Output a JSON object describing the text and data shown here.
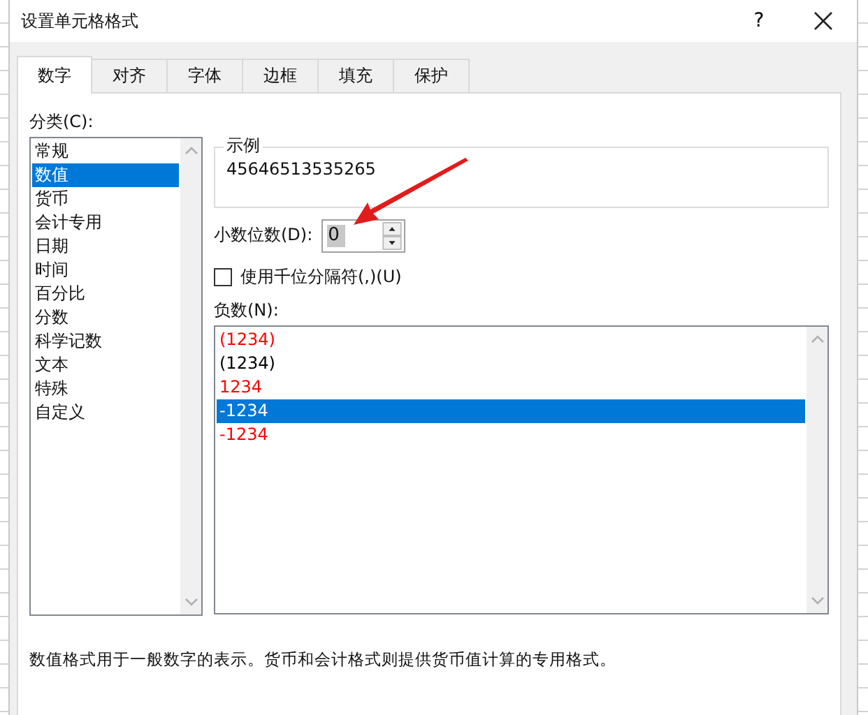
{
  "window": {
    "title": "设置单元格格式",
    "help": "?"
  },
  "tabs": [
    {
      "label": "数字",
      "selected": true
    },
    {
      "label": "对齐",
      "selected": false
    },
    {
      "label": "字体",
      "selected": false
    },
    {
      "label": "边框",
      "selected": false
    },
    {
      "label": "填充",
      "selected": false
    },
    {
      "label": "保护",
      "selected": false
    }
  ],
  "category": {
    "label": "分类(C):",
    "items": [
      {
        "label": "常规",
        "selected": false
      },
      {
        "label": "数值",
        "selected": true
      },
      {
        "label": "货币",
        "selected": false
      },
      {
        "label": "会计专用",
        "selected": false
      },
      {
        "label": "日期",
        "selected": false
      },
      {
        "label": "时间",
        "selected": false
      },
      {
        "label": "百分比",
        "selected": false
      },
      {
        "label": "分数",
        "selected": false
      },
      {
        "label": "科学记数",
        "selected": false
      },
      {
        "label": "文本",
        "selected": false
      },
      {
        "label": "特殊",
        "selected": false
      },
      {
        "label": "自定义",
        "selected": false
      }
    ]
  },
  "sample": {
    "label": "示例",
    "value": "45646513535265"
  },
  "decimal_places": {
    "label": "小数位数(D):",
    "value": "0"
  },
  "thousands_separator": {
    "label": "使用千位分隔符(,)(U)",
    "checked": false
  },
  "negative_numbers": {
    "label": "负数(N):",
    "items": [
      {
        "label": "(1234)",
        "color": "#ff0000",
        "selected": false
      },
      {
        "label": "(1234)",
        "color": "#000000",
        "selected": false
      },
      {
        "label": "1234",
        "color": "#ff0000",
        "selected": false
      },
      {
        "label": "-1234",
        "color": "#ffffff",
        "selected": true
      },
      {
        "label": "-1234",
        "color": "#ff0000",
        "selected": false
      }
    ]
  },
  "description": "数值格式用于一般数字的表示。货币和会计格式则提供货币值计算的专用格式。"
}
